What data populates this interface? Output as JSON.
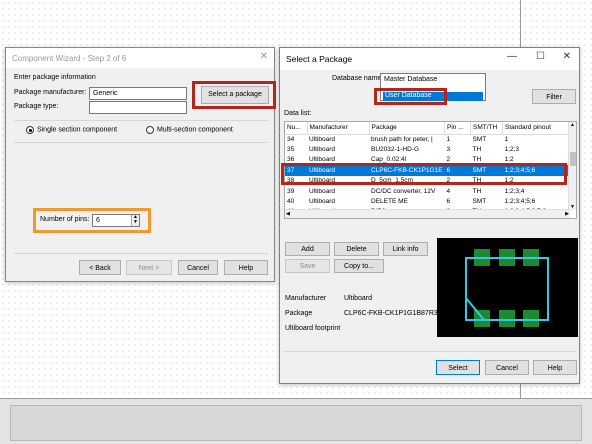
{
  "wizard": {
    "title": "Component Wizard - Step 2 of 6",
    "section_label": "Enter package information",
    "manufacturer_label": "Package manufacturer:",
    "manufacturer_value": "Generic",
    "type_label": "Package type:",
    "type_value": "",
    "select_package_label": "Select a package",
    "single_section_label": "Single section component",
    "multi_section_label": "Multi-section component",
    "pins_label": "Number of pins:",
    "pins_value": "6",
    "back_label": "< Back",
    "next_label": "Next >",
    "cancel_label": "Cancel",
    "help_label": "Help"
  },
  "select_package": {
    "title": "Select a Package",
    "db_name_label": "Database name:",
    "db_options": [
      "Master Database",
      "User Database"
    ],
    "db_selected": "User Database",
    "filter_label": "Filter",
    "data_list_label": "Data list:",
    "columns": [
      "Nu...",
      "Manufacturer",
      "Package",
      "Pin ...",
      "SMT/TH",
      "Standard pinout"
    ],
    "rows": [
      [
        "34",
        "Ultiboard",
        "brush path for peter, |",
        "1",
        "SMT",
        "1"
      ],
      [
        "35",
        "Ultiboard",
        "BU2032-1-HD-G",
        "3",
        "TH",
        "1;2;3"
      ],
      [
        "36",
        "Ultiboard",
        "Cap_0.02:4l",
        "2",
        "TH",
        "1;2"
      ],
      [
        "37",
        "Ultiboard",
        "CLP6C-FKB-CK1P1G1E",
        "6",
        "SMT",
        "1;2;3;4;5;6"
      ],
      [
        "38",
        "Ultiboard",
        "D_5cm_1.5cm",
        "2",
        "TH",
        "1;2"
      ],
      [
        "39",
        "Ultiboard",
        "DC/DC converter, 12V",
        "4",
        "TH",
        "1;2;3;4"
      ],
      [
        "40",
        "Ultiboard",
        "DELETE ME",
        "6",
        "SMT",
        "1;2;3;4;5;6"
      ],
      [
        "41",
        "Ultiboard",
        "DIP8",
        "8",
        "TH",
        "1;2;3;4;5;6;7;8"
      ]
    ],
    "selected_row": 3,
    "add_label": "Add",
    "delete_label": "Delete",
    "link_info_label": "Link info",
    "save_label": "Save",
    "copy_to_label": "Copy to...",
    "manufacturer_key": "Manufacturer",
    "manufacturer_val": "Ultiboard",
    "package_key": "Package",
    "package_val": "CLP6C-FKB-CK1P1G1B87R3R",
    "footprint_key": "Ultiboard footprint",
    "select_label": "Select",
    "cancel_label": "Cancel",
    "help_label": "Help"
  },
  "colors": {
    "highlight_red": "#b3261e",
    "highlight_orange": "#ed9a2f",
    "selection_blue": "#0078d7",
    "preview_bg": "#000000",
    "pad_green": "#1c8a2e",
    "outline_cyan": "#39c5e6"
  }
}
